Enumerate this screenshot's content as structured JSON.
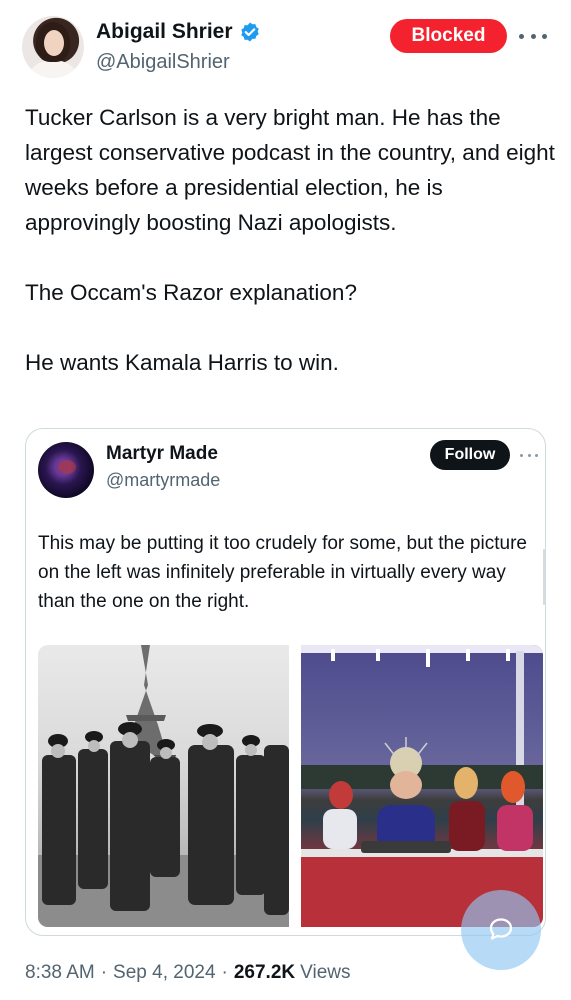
{
  "author": {
    "name": "Abigail Shrier",
    "handle": "@AbigailShrier",
    "verified": true,
    "avatar_icon": "profile-photo"
  },
  "actions": {
    "blocked_label": "Blocked",
    "more_icon": "ellipsis-icon"
  },
  "tweet": {
    "paragraphs": [
      "Tucker Carlson is a very bright man. He has the largest conservative podcast in the country, and eight weeks before a presidential election, he is approvingly boosting Nazi apologists.",
      "The Occam's Razor explanation?",
      "He wants Kamala Harris to win."
    ]
  },
  "quote": {
    "name": "Martyr Made",
    "handle": "@martyrmade",
    "follow_label": "Follow",
    "text": "This may be putting it too crudely for some, but the picture on the left was infinitely preferable in virtually every way than the one on the right.",
    "images": [
      {
        "name": "photo-left",
        "icon": "eiffel-tower-photo"
      },
      {
        "name": "photo-right",
        "icon": "stage-performers-photo"
      }
    ]
  },
  "meta": {
    "time": "8:38 AM",
    "date": "Sep 4, 2024",
    "views_count": "267.2K",
    "views_label": "Views",
    "separator": "·"
  },
  "colors": {
    "accent_blue": "#1d9bf0",
    "blocked_red": "#f4212e",
    "text_primary": "#0f1419",
    "text_secondary": "#536471",
    "border": "#cfd9de"
  }
}
